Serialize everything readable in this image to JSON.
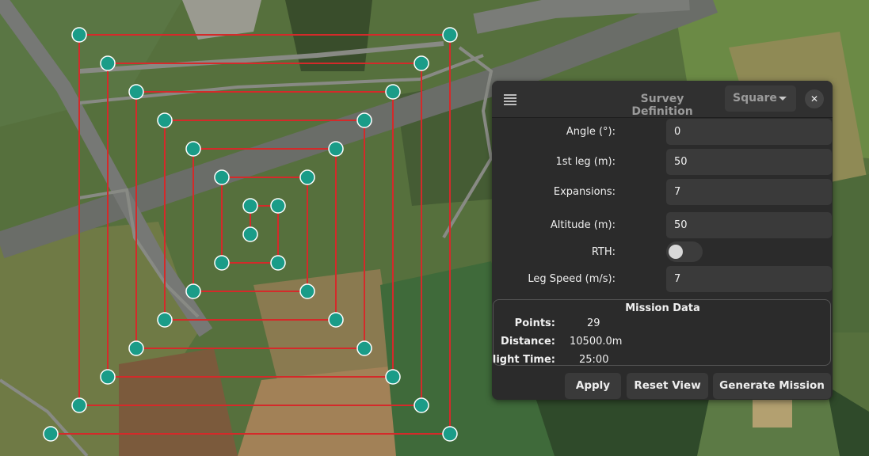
{
  "map": {
    "route_color": "#d42a2a",
    "waypoint_color": "#1a9c88",
    "waypoint_count": 29
  },
  "panel": {
    "menu_icon": "hamburger-icon",
    "title": "Survey Definition",
    "shape": {
      "selected": "Square",
      "icon": "chevron-down-icon"
    },
    "close": {
      "icon": "close-icon",
      "label": "✕"
    },
    "fields": {
      "angle": {
        "label": "Angle (°):",
        "value": "0"
      },
      "first_leg": {
        "label": "1st leg (m):",
        "value": "50"
      },
      "expansions": {
        "label": "Expansions:",
        "value": "7"
      },
      "altitude": {
        "label": "Altitude (m):",
        "value": "50"
      },
      "rth": {
        "label": "RTH:",
        "enabled": false
      },
      "leg_speed": {
        "label": "Leg Speed (m/s):",
        "value": "7"
      }
    },
    "mission": {
      "title": "Mission Data",
      "points_label": "Points:",
      "points_value": "29",
      "distance_label": "Distance:",
      "distance_value": "10500.0m",
      "flight_time_label": "Flight Time:",
      "flight_time_value": "25:00"
    },
    "buttons": {
      "apply": "Apply",
      "reset_view": "Reset View",
      "generate": "Generate Mission"
    }
  }
}
